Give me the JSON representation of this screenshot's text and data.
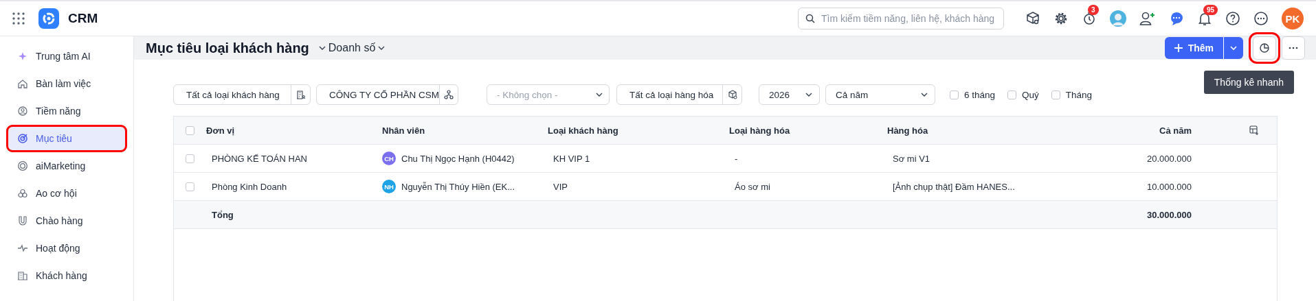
{
  "app": {
    "name": "CRM"
  },
  "search": {
    "placeholder": "Tìm kiếm tiềm năng, liên hệ, khách hàng"
  },
  "topbar_badges": {
    "timer": "3",
    "notifications": "95"
  },
  "user": {
    "initials": "PK"
  },
  "sidebar": {
    "items": [
      {
        "label": "Trung tâm AI",
        "selected": false,
        "highlighted": false
      },
      {
        "label": "Bàn làm việc",
        "selected": false,
        "highlighted": false
      },
      {
        "label": "Tiềm năng",
        "selected": false,
        "highlighted": false
      },
      {
        "label": "Mục tiêu",
        "selected": true,
        "highlighted": true
      },
      {
        "label": "aiMarketing",
        "selected": false,
        "highlighted": false
      },
      {
        "label": "Ao cơ hội",
        "selected": false,
        "highlighted": false
      },
      {
        "label": "Chào hàng",
        "selected": false,
        "highlighted": false
      },
      {
        "label": "Hoạt động",
        "selected": false,
        "highlighted": false
      },
      {
        "label": "Khách hàng",
        "selected": false,
        "highlighted": false
      }
    ]
  },
  "header": {
    "title": "Mục tiêu loại khách hàng",
    "view": "Doanh số",
    "add_button": "Thêm",
    "stats_button_highlighted": true,
    "tooltip": "Thống kê nhanh"
  },
  "filters": {
    "customer_type": "Tất cả loại khách hàng",
    "company": "CÔNG TY CỔ PHẦN CSM",
    "unit": {
      "placeholder": "- Không chọn -"
    },
    "product_type": "Tất cả loại hàng hóa",
    "year": "2026",
    "period": "Cả năm",
    "options": [
      {
        "label": "6 tháng",
        "checked": false
      },
      {
        "label": "Quý",
        "checked": false
      },
      {
        "label": "Tháng",
        "checked": false
      }
    ]
  },
  "table": {
    "columns": [
      "Đơn vị",
      "Nhân viên",
      "Loại khách hàng",
      "Loại hàng hóa",
      "Hàng hóa",
      "Cả năm"
    ],
    "all_checked": false,
    "rows": [
      {
        "checked": false,
        "unit": "PHÒNG KẾ TOÁN HAN",
        "employee": {
          "initials": "CH",
          "color": "#7b6ff0",
          "name": "Chu Thị Ngọc Hạnh (H0442)"
        },
        "customer_type": "KH VIP 1",
        "product_type": "-",
        "product": "Sơ mi V1",
        "year_total": "20.000.000"
      },
      {
        "checked": false,
        "unit": "Phòng Kinh Doanh",
        "employee": {
          "initials": "NH",
          "color": "#1ea3e6",
          "name": "Nguyễn Thị Thúy Hiền (EK..."
        },
        "customer_type": "VIP",
        "product_type": "Áo sơ mi",
        "product": "[Ảnh chụp thật] Đầm HANES...",
        "year_total": "10.000.000"
      }
    ],
    "total": {
      "label": "Tổng",
      "value": "30.000.000"
    }
  }
}
